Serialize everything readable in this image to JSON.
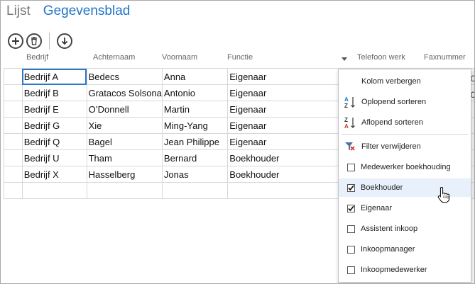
{
  "tabs": {
    "list": "Lijst",
    "datasheet": "Gegevensblad"
  },
  "toolbar": {
    "add_icon": "plus-circle-icon",
    "delete_icon": "trash-circle-icon",
    "download_icon": "arrow-down-circle-icon"
  },
  "columns": [
    "Bedrijf",
    "Achternaam",
    "Voornaam",
    "Functie",
    "Telefoon werk",
    "Faxnummer"
  ],
  "rows": [
    [
      "Bedrijf A",
      "Bedecs",
      "Anna",
      "Eigenaar"
    ],
    [
      "Bedrijf B",
      "Gratacos Solsona",
      "Antonio",
      "Eigenaar"
    ],
    [
      "Bedrijf E",
      "O’Donnell",
      "Martin",
      "Eigenaar"
    ],
    [
      "Bedrijf G",
      "Xie",
      "Ming-Yang",
      "Eigenaar"
    ],
    [
      "Bedrijf Q",
      "Bagel",
      "Jean Philippe",
      "Eigenaar"
    ],
    [
      "Bedrijf U",
      "Tham",
      "Bernard",
      "Boekhouder"
    ],
    [
      "Bedrijf X",
      "Hasselberg",
      "Jonas",
      "Boekhouder"
    ],
    [
      "",
      "",
      "",
      ""
    ]
  ],
  "menu": {
    "hide_column": "Kolom verbergen",
    "sort_asc": "Oplopend sorteren",
    "sort_desc": "Aflopend sorteren",
    "remove_filter": "Filter verwijderen",
    "filters": [
      {
        "label": "Medewerker boekhouding",
        "checked": false
      },
      {
        "label": "Boekhouder",
        "checked": true
      },
      {
        "label": "Eigenaar",
        "checked": true
      },
      {
        "label": "Assistent inkoop",
        "checked": false
      },
      {
        "label": "Inkoopmanager",
        "checked": false
      },
      {
        "label": "Inkoopmedewerker",
        "checked": false
      }
    ]
  },
  "colors": {
    "accent": "#1f73c8",
    "selection": "#2a78c8",
    "hover": "#e8f1fb"
  }
}
